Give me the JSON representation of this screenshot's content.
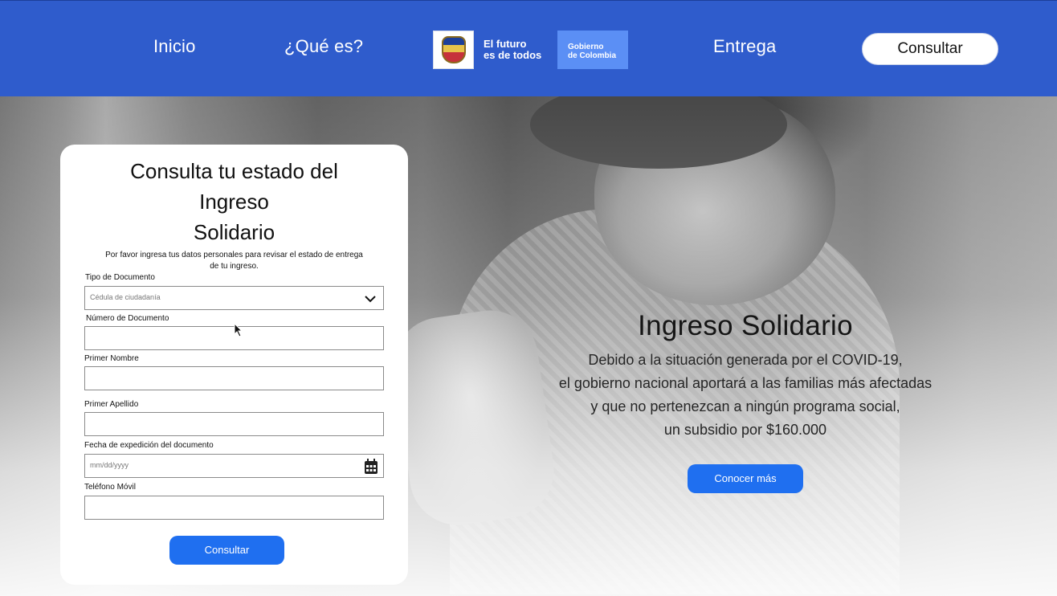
{
  "header": {
    "nav": [
      {
        "label": "Inicio"
      },
      {
        "label": "¿Qué es?"
      },
      {
        "label": "Entrega"
      }
    ],
    "logo": {
      "slogan_line1": "El futuro",
      "slogan_line2": "es de todos",
      "gov_line1": "Gobierno",
      "gov_line2": "de Colombia",
      "icon": "colombia-coat-of-arms-icon"
    },
    "cta_label": "Consultar"
  },
  "hero": {
    "title": "Ingreso Solidario",
    "description_lines": [
      "Debido a la situación generada por el COVID-19,",
      "el gobierno nacional aportará a las familias más afectadas",
      "y que no pertenezcan a ningún programa social,",
      "un subsidio por $160.000"
    ],
    "button_label": "Conocer más"
  },
  "form": {
    "title_lines": [
      "Consulta tu estado del",
      "Ingreso",
      "Solidario"
    ],
    "subtitle_line1": "Por favor ingresa tus datos personales para revisar el estado de entrega",
    "subtitle_line2": "de tu ingreso.",
    "fields": [
      {
        "label": "Tipo de Documento",
        "value": "Cédula de ciudadanía",
        "icon": "chevron-down-icon"
      },
      {
        "label": "Número de Documento",
        "value": ""
      },
      {
        "label": "Primer Nombre",
        "value": ""
      },
      {
        "label": "Primer Apellido",
        "value": ""
      },
      {
        "label": "Fecha de expedición del documento",
        "placeholder": "mm/dd/yyyy",
        "icon": "calendar-icon"
      },
      {
        "label": "Teléfono Móvil",
        "value": ""
      }
    ],
    "submit_label": "Consultar"
  },
  "colors": {
    "header_bg": "#2f5ccc",
    "primary_button": "#1f6ff0",
    "gov_box": "#5b8ff5"
  }
}
